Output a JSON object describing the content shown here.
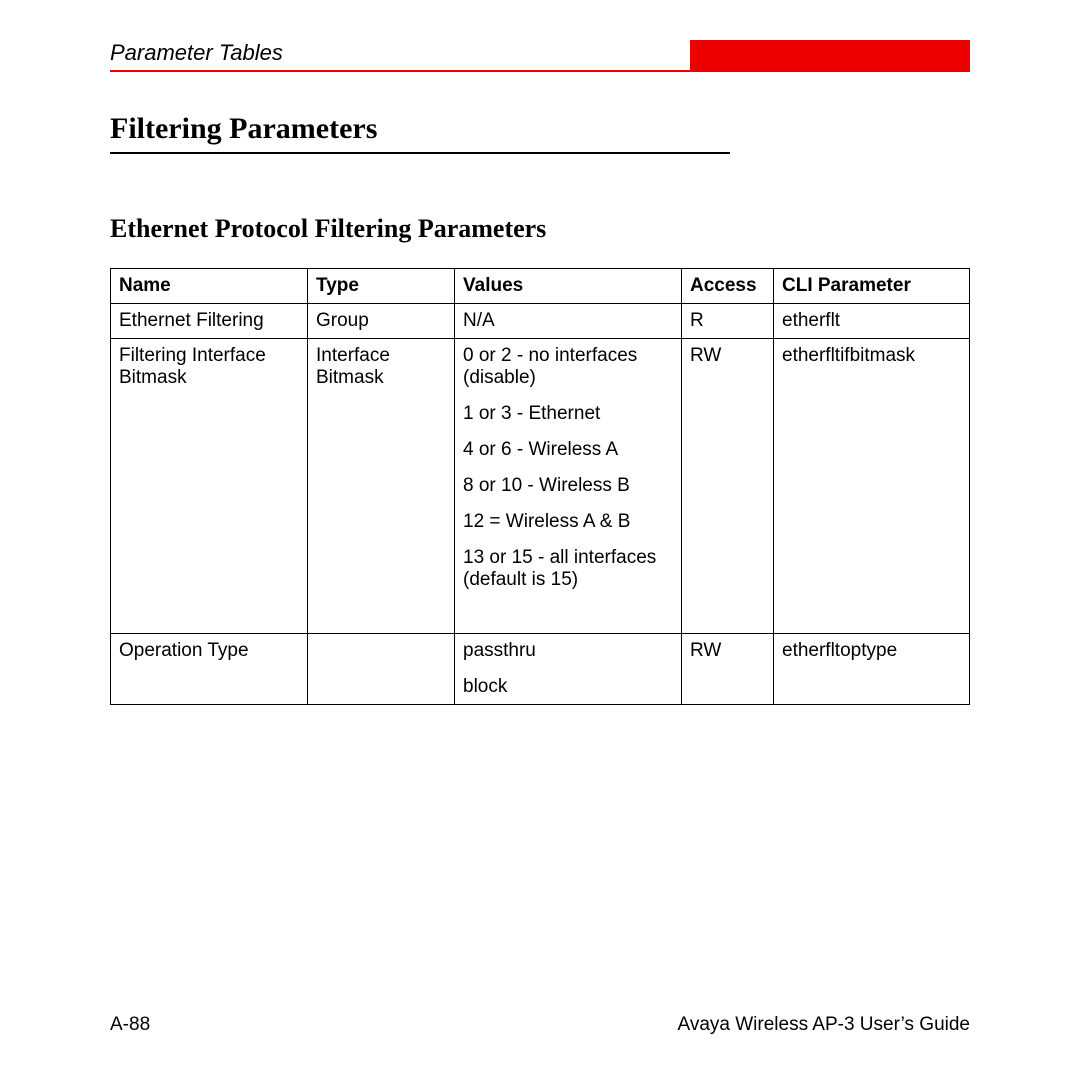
{
  "header": {
    "section": "Parameter Tables"
  },
  "titles": {
    "main": "Filtering Parameters",
    "sub": "Ethernet Protocol Filtering Parameters"
  },
  "table": {
    "headers": {
      "name": "Name",
      "type": "Type",
      "values": "Values",
      "access": "Access",
      "cli": "CLI Parameter"
    },
    "rows": [
      {
        "name": "Ethernet Filtering",
        "type": "Group",
        "values": [
          "N/A"
        ],
        "access": "R",
        "cli": "etherflt"
      },
      {
        "name": "Filtering Interface Bitmask",
        "type": "Interface Bitmask",
        "values": [
          "0 or 2 - no interfaces (disable)",
          "1 or 3 - Ethernet",
          "4 or 6 - Wireless A",
          "8 or 10 - Wireless B",
          "12 = Wireless A & B",
          "13 or 15 - all interfaces (default is 15)"
        ],
        "access": "RW",
        "cli": "etherfltifbitmask"
      },
      {
        "name": "Operation Type",
        "type": "",
        "values": [
          "passthru",
          "block"
        ],
        "access": "RW",
        "cli": "etherfltoptype"
      }
    ]
  },
  "footer": {
    "page": "A-88",
    "doc": "Avaya Wireless AP-3 User’s Guide"
  }
}
